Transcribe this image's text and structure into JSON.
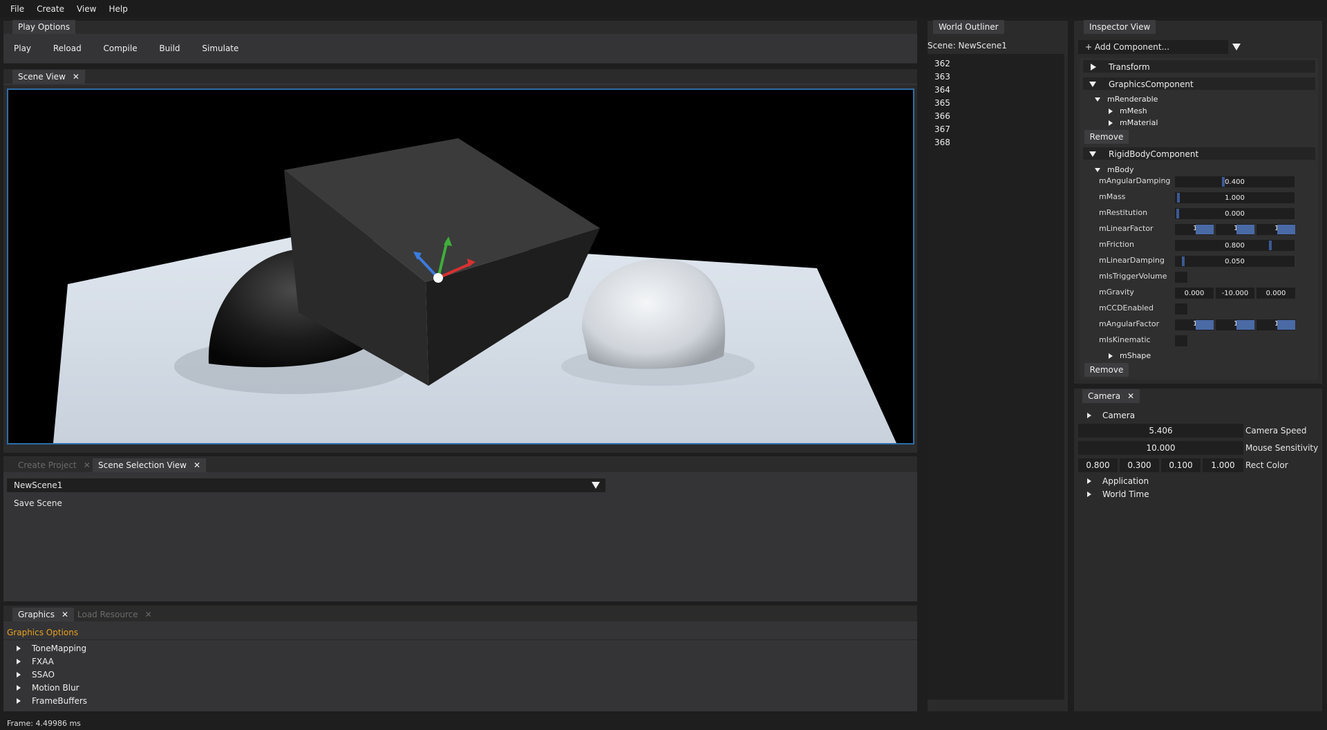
{
  "menu": [
    "File",
    "Create",
    "View",
    "Help"
  ],
  "play_options": {
    "tab": "Play Options",
    "buttons": [
      "Play",
      "Reload",
      "Compile",
      "Build",
      "Simulate"
    ]
  },
  "scene_view": {
    "tab": "Scene View",
    "close": "✕"
  },
  "bottom_tabs": {
    "create_project": "Create Project",
    "scene_selection": "Scene Selection View",
    "close": "✕"
  },
  "scene_selection": {
    "selected": "NewScene1",
    "save": "Save Scene"
  },
  "graphics": {
    "tab": "Graphics",
    "tab2": "Load Resource",
    "title": "Graphics Options",
    "items": [
      "ToneMapping",
      "FXAA",
      "SSAO",
      "Motion Blur",
      "FrameBuffers"
    ]
  },
  "status": {
    "frame": "Frame: 4.49986 ms"
  },
  "world_outliner": {
    "tab": "World Outliner",
    "scene": "Scene: NewScene1",
    "items": [
      "362",
      "363",
      "364",
      "365",
      "366",
      "367",
      "368"
    ]
  },
  "inspector": {
    "tab": "Inspector View",
    "add_component": "+ Add Component...",
    "transform": "Transform",
    "graphics_component": "GraphicsComponent",
    "renderable": "mRenderable",
    "mesh": "mMesh",
    "material": "mMaterial",
    "remove": "Remove",
    "rigidbody": "RigidBodyComponent",
    "body": "mBody",
    "props": {
      "angular_damping": {
        "label": "mAngularDamping",
        "value": "0.400",
        "level": 0.4
      },
      "mass": {
        "label": "mMass",
        "value": "1.000",
        "level": 0.0
      },
      "restitution": {
        "label": "mRestitution",
        "value": "0.000",
        "level": 0.0
      },
      "linear_factor": {
        "label": "mLinearFactor",
        "values": [
          "1",
          "1",
          "1"
        ]
      },
      "friction": {
        "label": "mFriction",
        "value": "0.800",
        "level": 0.8
      },
      "linear_damping": {
        "label": "mLinearDamping",
        "value": "0.050",
        "level": 0.05
      },
      "trigger": {
        "label": "mIsTriggerVolume"
      },
      "gravity": {
        "label": "mGravity",
        "values": [
          "0.000",
          "-10.000",
          "0.000"
        ]
      },
      "ccd": {
        "label": "mCCDEnabled"
      },
      "angular_factor": {
        "label": "mAngularFactor",
        "values": [
          "1",
          "1",
          "1"
        ]
      },
      "kinematic": {
        "label": "mIsKinematic"
      },
      "shape": {
        "label": "mShape"
      }
    }
  },
  "camera_panel": {
    "tab": "Camera",
    "camera": "Camera",
    "speed": {
      "value": "5.406",
      "label": "Camera Speed"
    },
    "sensitivity": {
      "value": "10.000",
      "label": "Mouse Sensitivity"
    },
    "rect_color": {
      "values": [
        "0.800",
        "0.300",
        "0.100",
        "1.000"
      ],
      "label": "Rect Color"
    },
    "application": "Application",
    "world_time": "World Time"
  },
  "colors": {
    "accent_blue": "#2d6ea8",
    "graphics_title": "#e8a020",
    "slider": "#3b5a93"
  }
}
